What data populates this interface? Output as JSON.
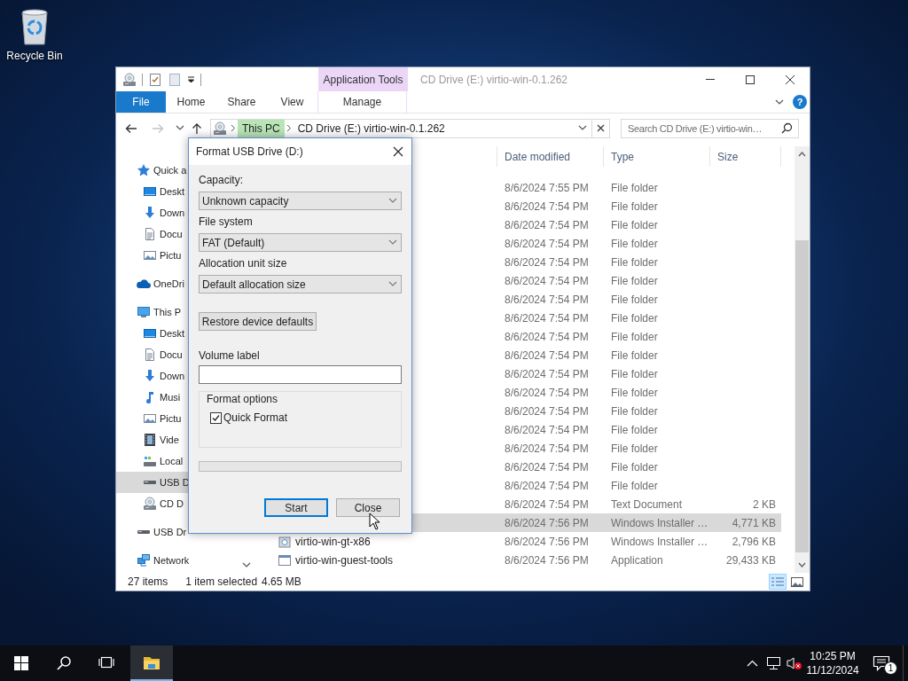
{
  "desktop": {
    "icons": [
      {
        "label": "Recycle Bin"
      }
    ]
  },
  "explorer": {
    "active": false,
    "contextual_group": "Application Tools",
    "title": "CD Drive (E:) virtio-win-0.1.262",
    "ribbon_tabs": [
      {
        "label": "File",
        "kind": "file",
        "selected": false
      },
      {
        "label": "Home",
        "kind": "standard",
        "selected": false
      },
      {
        "label": "Share",
        "kind": "standard",
        "selected": false
      },
      {
        "label": "View",
        "kind": "standard",
        "selected": false
      },
      {
        "label": "Manage",
        "kind": "contextual",
        "selected": false
      }
    ],
    "help_button": "?",
    "address_bar": {
      "segments": [
        {
          "label": "This PC",
          "highlighted": true
        },
        {
          "label": "CD Drive (E:) virtio-win-0.1.262",
          "highlighted": false
        }
      ]
    },
    "search": {
      "placeholder": "Search CD Drive (E:) virtio-win…"
    },
    "navigation": [
      {
        "label": "Quick a",
        "kind": "quick_access",
        "selected": false,
        "children": [
          {
            "label": "Deskt",
            "kind": "desktop",
            "selected": false
          },
          {
            "label": "Down",
            "kind": "downloads",
            "selected": false
          },
          {
            "label": "Docu",
            "kind": "documents",
            "selected": false
          },
          {
            "label": "Pictu",
            "kind": "pictures",
            "selected": false
          }
        ]
      },
      {
        "label": "OneDri",
        "kind": "onedrive",
        "selected": false
      },
      {
        "label": "This P",
        "kind": "this_pc",
        "selected": false,
        "children": [
          {
            "label": "Deskt",
            "kind": "desktop",
            "selected": false
          },
          {
            "label": "Docu",
            "kind": "documents",
            "selected": false
          },
          {
            "label": "Down",
            "kind": "downloads",
            "selected": false
          },
          {
            "label": "Musi",
            "kind": "music",
            "selected": false
          },
          {
            "label": "Pictu",
            "kind": "pictures",
            "selected": false
          },
          {
            "label": "Vide",
            "kind": "videos",
            "selected": false
          },
          {
            "label": "Local",
            "kind": "local_disk",
            "selected": false
          },
          {
            "label": "USB D",
            "kind": "usb_drive",
            "selected": true
          },
          {
            "label": "CD D",
            "kind": "cd_drive",
            "selected": false
          }
        ]
      },
      {
        "label": "USB Dr",
        "kind": "usb_drive",
        "selected": false
      },
      {
        "label": "Network",
        "kind": "network",
        "selected": false
      }
    ],
    "file_list": {
      "columns": [
        "Date modified",
        "Type",
        "Size"
      ],
      "rows": [
        {
          "date_modified": "8/6/2024 7:55 PM",
          "type": "File folder",
          "selected": false
        },
        {
          "date_modified": "8/6/2024 7:54 PM",
          "type": "File folder",
          "selected": false
        },
        {
          "date_modified": "8/6/2024 7:54 PM",
          "type": "File folder",
          "selected": false
        },
        {
          "date_modified": "8/6/2024 7:54 PM",
          "type": "File folder",
          "selected": false
        },
        {
          "date_modified": "8/6/2024 7:54 PM",
          "type": "File folder",
          "selected": false
        },
        {
          "date_modified": "8/6/2024 7:54 PM",
          "type": "File folder",
          "selected": false
        },
        {
          "date_modified": "8/6/2024 7:54 PM",
          "type": "File folder",
          "selected": false
        },
        {
          "date_modified": "8/6/2024 7:54 PM",
          "type": "File folder",
          "selected": false
        },
        {
          "date_modified": "8/6/2024 7:54 PM",
          "type": "File folder",
          "selected": false
        },
        {
          "date_modified": "8/6/2024 7:54 PM",
          "type": "File folder",
          "selected": false
        },
        {
          "date_modified": "8/6/2024 7:54 PM",
          "type": "File folder",
          "selected": false
        },
        {
          "date_modified": "8/6/2024 7:54 PM",
          "type": "File folder",
          "selected": false
        },
        {
          "date_modified": "8/6/2024 7:54 PM",
          "type": "File folder",
          "selected": false
        },
        {
          "date_modified": "8/6/2024 7:54 PM",
          "type": "File folder",
          "selected": false
        },
        {
          "date_modified": "8/6/2024 7:54 PM",
          "type": "File folder",
          "selected": false
        },
        {
          "date_modified": "8/6/2024 7:54 PM",
          "type": "File folder",
          "selected": false
        },
        {
          "date_modified": "8/6/2024 7:54 PM",
          "type": "File folder",
          "selected": false
        },
        {
          "date_modified": "8/6/2024 7:54 PM",
          "type": "Text Document",
          "size": "2 KB",
          "selected": false
        },
        {
          "date_modified": "8/6/2024 7:56 PM",
          "type": "Windows Installer …",
          "size": "4,771 KB",
          "selected": true
        },
        {
          "name": "virtio-win-gt-x86",
          "kind": "installer",
          "date_modified": "8/6/2024 7:56 PM",
          "type": "Windows Installer …",
          "size": "2,796 KB",
          "selected": false
        },
        {
          "name": "virtio-win-guest-tools",
          "kind": "application",
          "date_modified": "8/6/2024 7:56 PM",
          "type": "Application",
          "size": "29,433 KB",
          "selected": false
        }
      ]
    },
    "status_bar": {
      "item_count": "27 items",
      "selection": "1 item selected",
      "selection_size": "4.65 MB"
    },
    "view_buttons": [
      {
        "kind": "details",
        "selected": true
      },
      {
        "kind": "large_icons",
        "selected": false
      }
    ]
  },
  "dialog": {
    "title": "Format USB Drive (D:)",
    "dropdowns": [
      {
        "label": "Capacity:",
        "value": "Unknown capacity"
      },
      {
        "label": "File system",
        "value": "FAT (Default)"
      },
      {
        "label": "Allocation unit size",
        "value": "Default allocation size"
      }
    ],
    "restore_button": "Restore device defaults",
    "volume_label": {
      "label": "Volume label"
    },
    "format_options": {
      "title": "Format options",
      "checkboxes": [
        {
          "label": "Quick Format",
          "checked": true
        }
      ]
    },
    "progress": {
      "level": 0
    },
    "buttons": [
      {
        "label": "Start",
        "default": true
      },
      {
        "label": "Close",
        "default": false
      }
    ]
  },
  "taskbar": {
    "buttons": [
      {
        "kind": "start",
        "active": false
      },
      {
        "kind": "search",
        "active": false
      },
      {
        "kind": "task_view",
        "active": false
      },
      {
        "kind": "file_explorer",
        "active": true
      }
    ],
    "tray": [
      {
        "kind": "overflow"
      },
      {
        "kind": "network"
      },
      {
        "kind": "volume",
        "muted": true
      }
    ],
    "clock": {
      "time": "10:25 PM",
      "date": "11/12/2024"
    },
    "notifications": {
      "count": "1"
    }
  }
}
